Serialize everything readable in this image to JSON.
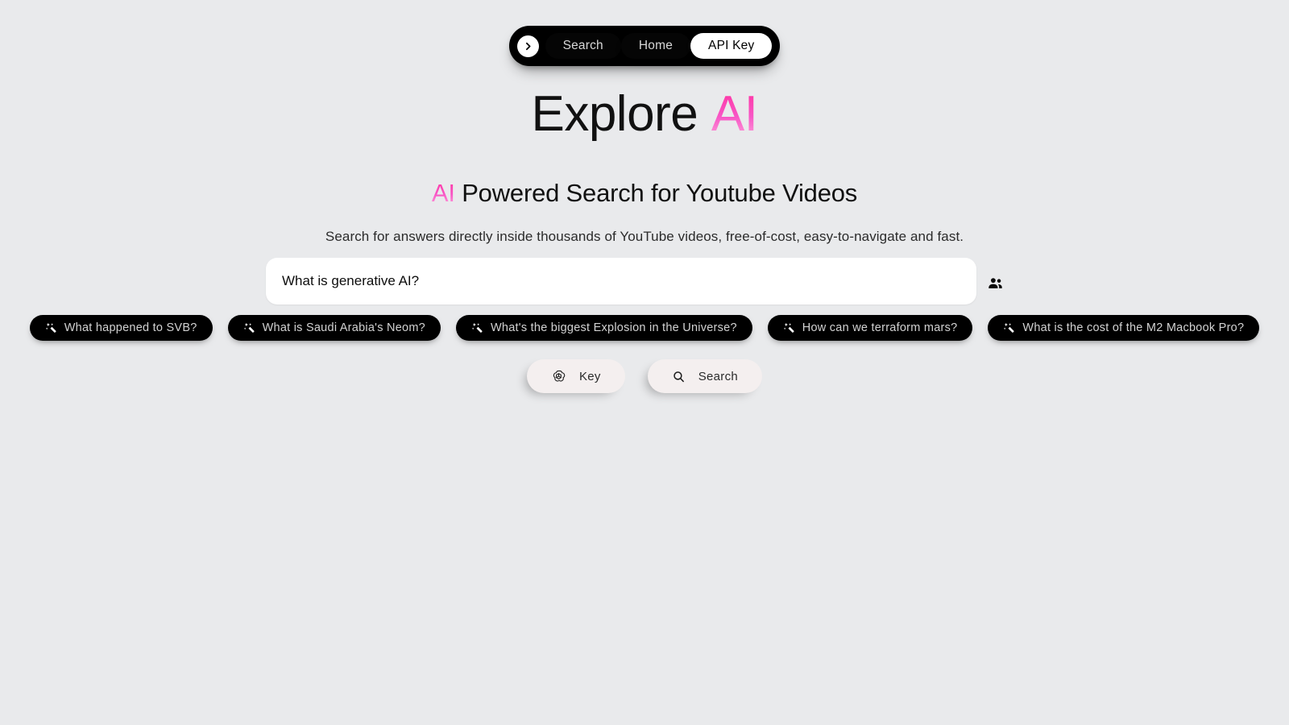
{
  "navbar": {
    "toggle_icon": "chevron-right-icon",
    "items": [
      {
        "label": "Search",
        "active": false
      },
      {
        "label": "Home",
        "active": false
      },
      {
        "label": "API Key",
        "active": true
      }
    ]
  },
  "hero": {
    "title_main": "Explore",
    "title_accent": "AI",
    "subtitle_accent": "AI",
    "subtitle_rest": " Powered Search for Youtube Videos",
    "tagline": "Search for answers directly inside thousands of YouTube videos, free-of-cost, easy-to-navigate and fast."
  },
  "search": {
    "value": "What is generative AI?",
    "placeholder": "What is generative AI?",
    "people_icon": "people-icon"
  },
  "suggestions": [
    {
      "icon": "magic-wand-icon",
      "label": "What happened to SVB?"
    },
    {
      "icon": "magic-wand-icon",
      "label": "What is Saudi Arabia's Neom?"
    },
    {
      "icon": "magic-wand-icon",
      "label": "What's the biggest Explosion in the Universe?"
    },
    {
      "icon": "magic-wand-icon",
      "label": "How can we terraform mars?"
    },
    {
      "icon": "magic-wand-icon",
      "label": "What is the cost of the M2 Macbook Pro?"
    }
  ],
  "actions": {
    "key_label": "Key",
    "key_icon": "openai-logo-icon",
    "search_label": "Search",
    "search_icon": "search-icon"
  },
  "colors": {
    "background": "#e9eaec",
    "accent_pink": "#ff2f9e",
    "accent_pink_light": "#ffa8dd",
    "nav_black": "#000000",
    "button_surface": "#f4efef",
    "input_surface": "#ffffff"
  }
}
